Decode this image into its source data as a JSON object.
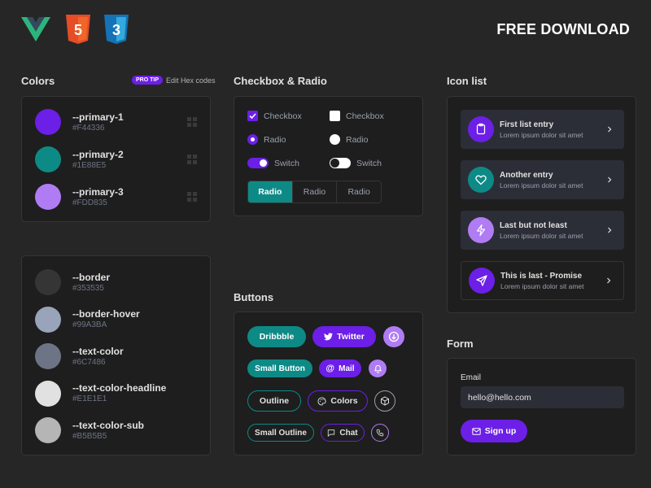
{
  "header": {
    "logos": [
      "vue-logo",
      "html5-logo",
      "css3-logo"
    ],
    "html5_text": "5",
    "css3_text": "3",
    "download_label": "FREE DOWNLOAD"
  },
  "colors_section": {
    "title": "Colors",
    "protip_badge": "PRO TIP",
    "protip_text": "Edit Hex codes",
    "primary": [
      {
        "name": "--primary-1",
        "hex": "#F44336",
        "swatch": "#6C1FE6"
      },
      {
        "name": "--primary-2",
        "hex": "#1E88E5",
        "swatch": "#0E8A86"
      },
      {
        "name": "--primary-3",
        "hex": "#FDD835",
        "swatch": "#B07CF4"
      }
    ],
    "neutral": [
      {
        "name": "--border",
        "hex": "#353535",
        "swatch": "#353535"
      },
      {
        "name": "--border-hover",
        "hex": "#99A3BA",
        "swatch": "#99A3BA"
      },
      {
        "name": "--text-color",
        "hex": "#6C7486",
        "swatch": "#6C7486"
      },
      {
        "name": "--text-color-headline",
        "hex": "#E1E1E1",
        "swatch": "#E1E1E1"
      },
      {
        "name": "--text-color-sub",
        "hex": "#B5B5B5",
        "swatch": "#B5B5B5"
      }
    ]
  },
  "checkbox_section": {
    "title": "Checkbox & Radio",
    "checkbox_label": "Checkbox",
    "radio_label": "Radio",
    "switch_label": "Switch",
    "segmented": [
      "Radio",
      "Radio",
      "Radio"
    ],
    "segmented_active_index": 0
  },
  "buttons_section": {
    "title": "Buttons",
    "dribbble": "Dribbble",
    "twitter": "Twitter",
    "small_button": "Small Button",
    "mail": "Mail",
    "outline": "Outline",
    "colors": "Colors",
    "small_outline": "Small Outline",
    "chat": "Chat"
  },
  "icon_list_section": {
    "title": "Icon list",
    "items": [
      {
        "title": "First list entry",
        "sub": "Lorem ipsum dolor sit amet",
        "icon": "clipboard-icon",
        "color": "#6C1FE6"
      },
      {
        "title": "Another entry",
        "sub": "Lorem ipsum dolor sit amet",
        "icon": "heart-icon",
        "color": "#0E8A86"
      },
      {
        "title": "Last but not least",
        "sub": "Lorem ipsum dolor sit amet",
        "icon": "bolt-icon",
        "color": "#B07CF4"
      },
      {
        "title": "This is last - Promise",
        "sub": "Lorem ipsum dolor sit amet",
        "icon": "send-icon",
        "color": "#6C1FE6"
      }
    ]
  },
  "form_section": {
    "title": "Form",
    "email_label": "Email",
    "email_value": "hello@hello.com",
    "signup_label": "Sign up"
  },
  "theme": {
    "accent_purple": "#6C1FE6",
    "accent_teal": "#0E8A86",
    "accent_lavender": "#B07CF4",
    "background": "#262626",
    "card": "#1E1E1E",
    "border": "#353535"
  }
}
